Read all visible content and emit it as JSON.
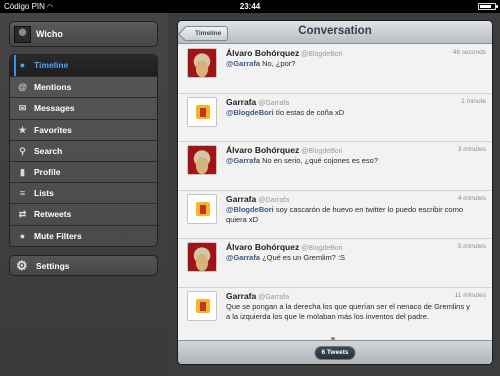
{
  "status_bar": {
    "carrier": "Código PIN",
    "time": "23:44",
    "battery_level": 0.8
  },
  "sidebar": {
    "account": {
      "name": "Wicho"
    },
    "items": [
      {
        "label": "Timeline",
        "icon": "speech-bubble-icon",
        "active": true
      },
      {
        "label": "Mentions",
        "icon": "at-sign-icon"
      },
      {
        "label": "Messages",
        "icon": "envelope-icon"
      },
      {
        "label": "Favorites",
        "icon": "star-icon"
      },
      {
        "label": "Search",
        "icon": "magnifier-icon"
      },
      {
        "label": "Profile",
        "icon": "person-icon"
      },
      {
        "label": "Lists",
        "icon": "list-icon"
      },
      {
        "label": "Retweets",
        "icon": "retweet-icon"
      },
      {
        "label": "Mute Filters",
        "icon": "mute-bubble-icon"
      }
    ],
    "settings": {
      "label": "Settings",
      "icon": "gear-icon"
    }
  },
  "conversation": {
    "back_label": "Timeline",
    "title": "Conversation",
    "tweets": [
      {
        "author": "Álvaro Bohórquez",
        "handle": "@BlogdeBori",
        "time": "48 seconds",
        "mention": "@Garrafa",
        "text": " No, ¿por?"
      },
      {
        "author": "Garrafa",
        "handle": "@Garrafa",
        "time": "1 minute",
        "mention": "@BlogdeBori",
        "text": " tío estas de coña xD"
      },
      {
        "author": "Álvaro Bohórquez",
        "handle": "@BlogdeBori",
        "time": "3 minutes",
        "mention": "@Garrafa",
        "text": " No en serio, ¿qué cojones es eso?"
      },
      {
        "author": "Garrafa",
        "handle": "@Garrafa",
        "time": "4 minutes",
        "mention": "@BlogdeBori",
        "text": " soy cascarón de huevo en twitter lo puedo escribir como quiera xD"
      },
      {
        "author": "Álvaro Bohórquez",
        "handle": "@BlogdeBori",
        "time": "5 minutes",
        "mention": "@Garrafa",
        "text": " ¿Qué es un Gremlim? :S"
      },
      {
        "author": "Garrafa",
        "handle": "@Garrafa",
        "time": "11 minutes",
        "mention": "",
        "text": "Que se pongan a la derecha los que querían ser el nenaco de Gremlins y a la izquierda los que le molaban más los inventos del padre."
      }
    ],
    "footer_count": "6 Tweets"
  }
}
